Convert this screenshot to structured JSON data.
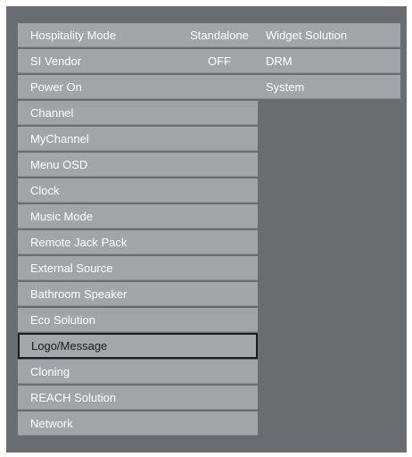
{
  "left_menu": {
    "items": [
      {
        "label": "Hospitality Mode",
        "value": "Standalone"
      },
      {
        "label": "SI Vendor",
        "value": "OFF"
      },
      {
        "label": "Power On",
        "value": ""
      },
      {
        "label": "Channel",
        "value": ""
      },
      {
        "label": "MyChannel",
        "value": ""
      },
      {
        "label": "Menu OSD",
        "value": ""
      },
      {
        "label": "Clock",
        "value": ""
      },
      {
        "label": "Music Mode",
        "value": ""
      },
      {
        "label": "Remote Jack Pack",
        "value": ""
      },
      {
        "label": "External Source",
        "value": ""
      },
      {
        "label": "Bathroom Speaker",
        "value": ""
      },
      {
        "label": "Eco Solution",
        "value": ""
      },
      {
        "label": "Logo/Message",
        "value": ""
      },
      {
        "label": "Cloning",
        "value": ""
      },
      {
        "label": "REACH Solution",
        "value": ""
      },
      {
        "label": "Network",
        "value": ""
      }
    ],
    "selected_label": "Logo/Message"
  },
  "right_menu": {
    "items": [
      {
        "label": "Widget Solution"
      },
      {
        "label": "DRM"
      },
      {
        "label": "System"
      }
    ]
  }
}
